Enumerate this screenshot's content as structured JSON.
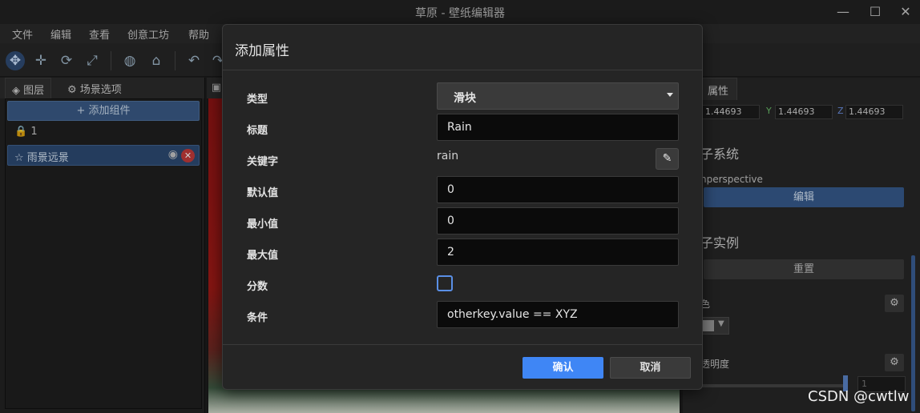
{
  "window": {
    "title": "草原 - 壁纸编辑器"
  },
  "menu": [
    "文件",
    "编辑",
    "查看",
    "创意工坊",
    "帮助"
  ],
  "left_panel": {
    "tabs": [
      "图层",
      "场景选项"
    ],
    "add_component": "添加组件",
    "layer_count": "1",
    "layer_name": "雨景远景"
  },
  "right_panel": {
    "tab": "属性",
    "scale": {
      "x": "1.44693",
      "y": "1.44693",
      "z": "1.44693",
      "y_label": "Y",
      "z_label": "Z"
    },
    "section1": "子系统",
    "perspective": "nperspective",
    "edit_button": "编辑",
    "section2": "子实例",
    "reset_button": "重置",
    "color_label": "色",
    "opacity_label": "透明度",
    "opacity_value": "1"
  },
  "modal": {
    "title": "添加属性",
    "labels": {
      "type": "类型",
      "title": "标题",
      "keyword": "关键字",
      "default": "默认值",
      "min": "最小值",
      "max": "最大值",
      "fraction": "分数",
      "condition": "条件"
    },
    "values": {
      "type": "滑块",
      "title": "Rain",
      "keyword": "rain",
      "default": "0",
      "min": "0",
      "max": "2",
      "fraction_checked": false,
      "condition": "otherkey.value == XYZ"
    },
    "confirm": "确认",
    "cancel": "取消"
  },
  "watermark": "CSDN @cwtlw"
}
